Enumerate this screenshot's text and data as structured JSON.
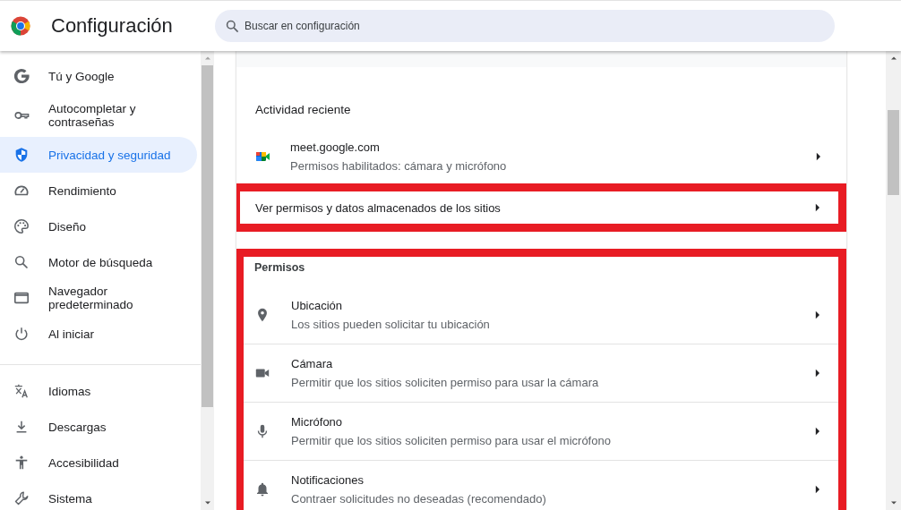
{
  "header": {
    "title": "Configuración",
    "search": {
      "placeholder": "Buscar en configuración"
    }
  },
  "sidebar": {
    "groups": [
      {
        "items": [
          {
            "kind": "google",
            "label": "Tú y Google",
            "selected": false
          },
          {
            "kind": "key",
            "label": "Autocompletar y contraseñas",
            "selected": false
          },
          {
            "kind": "shield",
            "label": "Privacidad y seguridad",
            "selected": true
          },
          {
            "kind": "gauge",
            "label": "Rendimiento",
            "selected": false
          },
          {
            "kind": "palette",
            "label": "Diseño",
            "selected": false
          },
          {
            "kind": "search",
            "label": "Motor de búsqueda",
            "selected": false
          },
          {
            "kind": "browser",
            "label": "Navegador predeterminado",
            "selected": false
          },
          {
            "kind": "power",
            "label": "Al iniciar",
            "selected": false
          }
        ]
      },
      {
        "items": [
          {
            "kind": "translate",
            "label": "Idiomas",
            "selected": false
          },
          {
            "kind": "download",
            "label": "Descargas",
            "selected": false
          },
          {
            "kind": "accessibility",
            "label": "Accesibilidad",
            "selected": false
          },
          {
            "kind": "wrench",
            "label": "Sistema",
            "selected": false
          }
        ]
      }
    ]
  },
  "main": {
    "recent_activity": {
      "heading": "Actividad reciente",
      "sites": [
        {
          "site": "meet.google.com",
          "detail": "Permisos habilitados: cámara y micrófono"
        }
      ]
    },
    "site_settings_link": {
      "label": "Ver permisos y datos almacenados de los sitios",
      "highlighted": true
    },
    "permissions": {
      "heading": "Permisos",
      "highlighted": true,
      "items": [
        {
          "kind": "location",
          "title": "Ubicación",
          "subtitle": "Los sitios pueden solicitar tu ubicación"
        },
        {
          "kind": "camera",
          "title": "Cámara",
          "subtitle": "Permitir que los sitios soliciten permiso para usar la cámara"
        },
        {
          "kind": "microphone",
          "title": "Micrófono",
          "subtitle": "Permitir que los sitios soliciten permiso para usar el micrófono"
        },
        {
          "kind": "bell",
          "title": "Notificaciones",
          "subtitle": "Contraer solicitudes no deseadas (recomendado)"
        }
      ]
    }
  }
}
